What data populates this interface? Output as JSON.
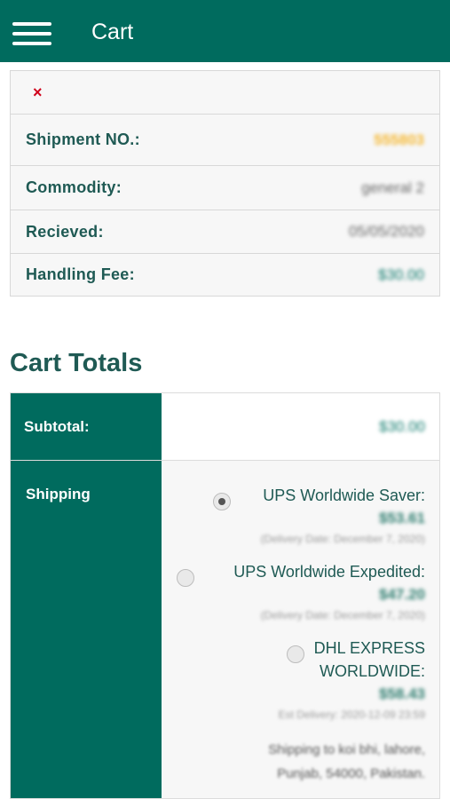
{
  "header": {
    "title": "Cart",
    "menu_icon": "hamburger-menu-icon"
  },
  "item": {
    "remove_symbol": "×",
    "remove_icon": "close-icon",
    "rows": [
      {
        "label": "Shipment NO.:",
        "value": "555803",
        "value_color": "#f5b833"
      },
      {
        "label": "Commodity:",
        "value": "general 2"
      },
      {
        "label": "Recieved:",
        "value": "05/05/2020"
      },
      {
        "label": "Handling Fee:",
        "value": "$30.00"
      }
    ]
  },
  "totals": {
    "heading": "Cart Totals",
    "subtotal_label": "Subtotal:",
    "subtotal_value": "$30.00",
    "shipping_label": "Shipping",
    "options": [
      {
        "name": "UPS Worldwide Saver:",
        "price": "$53.61",
        "date": "(Delivery Date: December 7, 2020)",
        "selected": true
      },
      {
        "name": "UPS Worldwide Expedited:",
        "price": "$47.20",
        "date": "(Delivery Date: December 7, 2020)",
        "selected": false
      },
      {
        "name_line1": "DHL EXPRESS",
        "name_line2": "WORLDWIDE:",
        "price": "$58.43",
        "date": "Est Delivery: 2020-12-09 23:59",
        "selected": false
      }
    ],
    "address_line1": "Shipping to koi bhi, lahore,",
    "address_line2": "Punjab, 54000, Pakistan."
  },
  "colors": {
    "brand": "#006b5e",
    "heading_text": "#1f5a54",
    "remove": "#d0021b",
    "shipment_accent": "#f5b833"
  }
}
